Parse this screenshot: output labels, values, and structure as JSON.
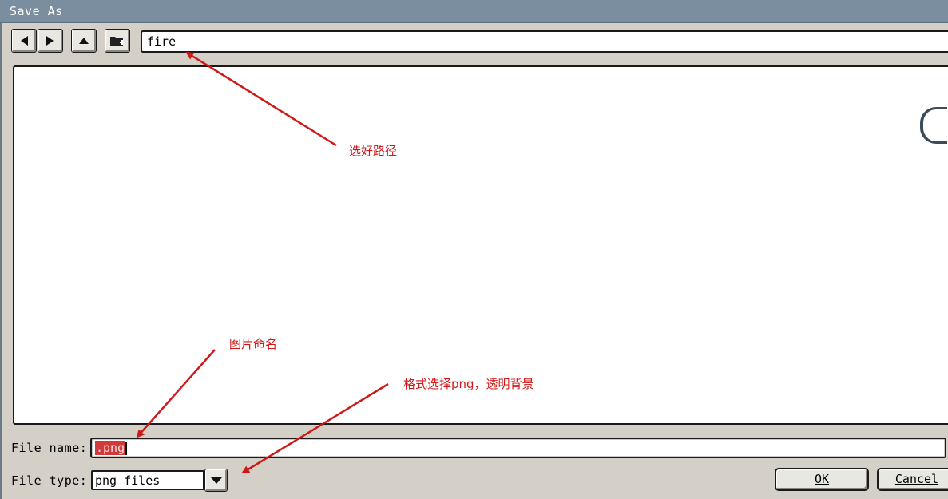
{
  "window": {
    "title": "Save As"
  },
  "toolbar": {
    "back_icon": "triangle-left-icon",
    "forward_icon": "triangle-right-icon",
    "up_icon": "triangle-up-icon",
    "new_folder_icon": "folder-plus-icon",
    "path_value": "fire"
  },
  "file_name": {
    "label": "File name:",
    "value_selected": ".png"
  },
  "file_type": {
    "label": "File type:",
    "value": "png files"
  },
  "buttons": {
    "ok": "OK",
    "cancel": "Cancel"
  },
  "annotations": {
    "path_note": "选好路径",
    "name_note": "图片命名",
    "type_note": "格式选择png，透明背景",
    "color": "#d01818"
  }
}
